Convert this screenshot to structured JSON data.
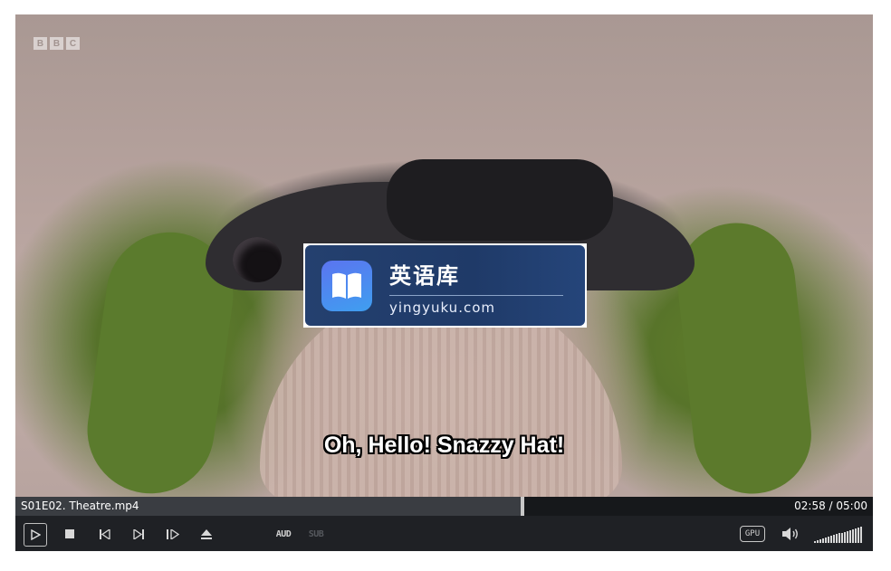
{
  "player": {
    "watermark": [
      "B",
      "B",
      "C"
    ],
    "logo": {
      "chinese": "英语库",
      "domain": "yingyuku.com"
    },
    "subtitle": "Oh, Hello! Snazzy Hat!",
    "seek": {
      "filename": "S01E02. Theatre.mp4",
      "time": "02:58 / 05:00",
      "progress": 0.593
    },
    "controls": {
      "play_icon": "play-icon",
      "stop_icon": "stop-icon",
      "prev_icon": "skip-previous-icon",
      "next_icon": "skip-next-icon",
      "frame_step_icon": "frame-step-icon",
      "eject_icon": "eject-icon",
      "audio_label": "AUD",
      "subtitle_label": "SUB",
      "gpu_label": "GPU",
      "volume_icon": "speaker-icon",
      "volume_level": 1.0
    }
  }
}
